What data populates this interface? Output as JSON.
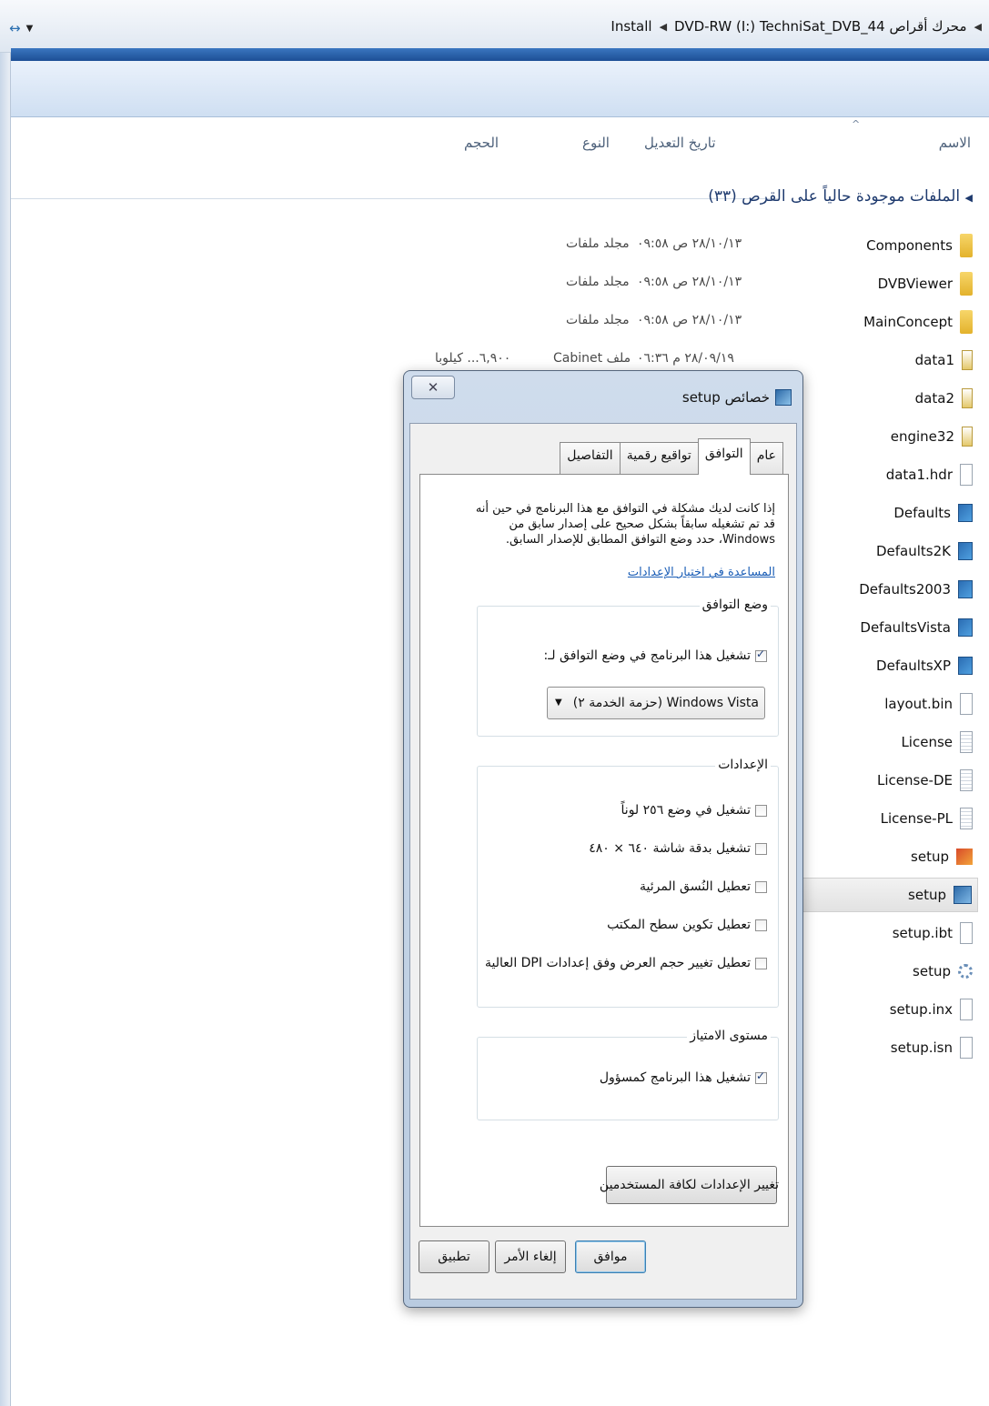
{
  "window": {
    "breadcrumb": [
      "محرك أقراص DVD-RW (I:) TechniSat_DVB_44",
      "Install"
    ],
    "nav_button_glyph": "↔"
  },
  "columns": {
    "name": "الاسم",
    "date_modified": "تاريخ التعديل",
    "type": "النوع",
    "size": "الحجم"
  },
  "group": {
    "title": "الملفات موجودة حالياً على القرص (٣٣)"
  },
  "files": [
    {
      "name": "Components",
      "icon": "folder"
    },
    {
      "name": "DVBViewer",
      "icon": "folder"
    },
    {
      "name": "MainConcept",
      "icon": "folder"
    },
    {
      "name": "data1",
      "icon": "cab"
    },
    {
      "name": "data2",
      "icon": "cab"
    },
    {
      "name": "engine32",
      "icon": "cab"
    },
    {
      "name": "data1.hdr",
      "icon": "doc"
    },
    {
      "name": "Defaults",
      "icon": "inst"
    },
    {
      "name": "Defaults2K",
      "icon": "inst"
    },
    {
      "name": "Defaults2003",
      "icon": "inst"
    },
    {
      "name": "DefaultsVista",
      "icon": "inst"
    },
    {
      "name": "DefaultsXP",
      "icon": "inst"
    },
    {
      "name": "layout.bin",
      "icon": "doc"
    },
    {
      "name": "License",
      "icon": "txt"
    },
    {
      "name": "License-DE",
      "icon": "txt"
    },
    {
      "name": "License-PL",
      "icon": "txt"
    },
    {
      "name": "setup",
      "icon": "setup1"
    },
    {
      "name": "setup",
      "icon": "setup2"
    },
    {
      "name": "setup.ibt",
      "icon": "doc"
    },
    {
      "name": "setup",
      "icon": "gear"
    },
    {
      "name": "setup.inx",
      "icon": "doc"
    },
    {
      "name": "setup.isn",
      "icon": "doc"
    }
  ],
  "file_details": [
    {
      "date": "٢٨/١٠/١٣ ص ٠٩:٥٨",
      "type": "مجلد ملفات",
      "size": ""
    },
    {
      "date": "٢٨/١٠/١٣ ص ٠٩:٥٨",
      "type": "مجلد ملفات",
      "size": ""
    },
    {
      "date": "٢٨/١٠/١٣ ص ٠٩:٥٨",
      "type": "مجلد ملفات",
      "size": ""
    },
    {
      "date": "٢٨/٠٩/١٩ م ٠٦:٣٦",
      "type": "ملف Cabinet",
      "size": "٦,٩٠٠... كيلوبا"
    }
  ],
  "dialog": {
    "title": "خصائص setup",
    "close_glyph": "✕",
    "tabs": [
      "عام",
      "التوافق",
      "تواقيع رقمية",
      "التفاصيل"
    ],
    "active_tab_index": 1,
    "description": "إذا كانت لديك مشكلة في التوافق مع هذا البرنامج في حين أنه قد تم تشغيله سابقاً بشكل صحيح على إصدار سابق من Windows، حدد وضع التوافق المطابق للإصدار السابق.",
    "help_link": "المساعدة في اختيار الإعدادات",
    "compat_group": {
      "label": "وضع التوافق",
      "checkbox_label": "تشغيل هذا البرنامج في وضع التوافق لـ:",
      "checked": true,
      "selected_os": "Windows Vista (حزمة الخدمة ٢)"
    },
    "settings_group": {
      "label": "الإعدادات",
      "items": [
        {
          "label": "تشغيل في وضع ٢٥٦ لوناً",
          "checked": false
        },
        {
          "label": "تشغيل بدقة شاشة ٦٤٠ × ٤٨٠",
          "checked": false
        },
        {
          "label": "تعطيل النُسق المرئية",
          "checked": false
        },
        {
          "label": "تعطيل تكوين سطح المكتب",
          "checked": false
        },
        {
          "label": "تعطيل تغيير حجم العرض وفق إعدادات DPI العالية",
          "checked": false
        }
      ]
    },
    "privilege_group": {
      "label": "مستوى الامتياز",
      "checkbox_label": "تشغيل هذا البرنامج كمسؤول",
      "checked": true
    },
    "change_all_button": "تغيير الإعدادات لكافة المستخدمين",
    "ok_button": "موافق",
    "cancel_button": "إلغاء الأمر",
    "apply_button": "تطبيق"
  }
}
